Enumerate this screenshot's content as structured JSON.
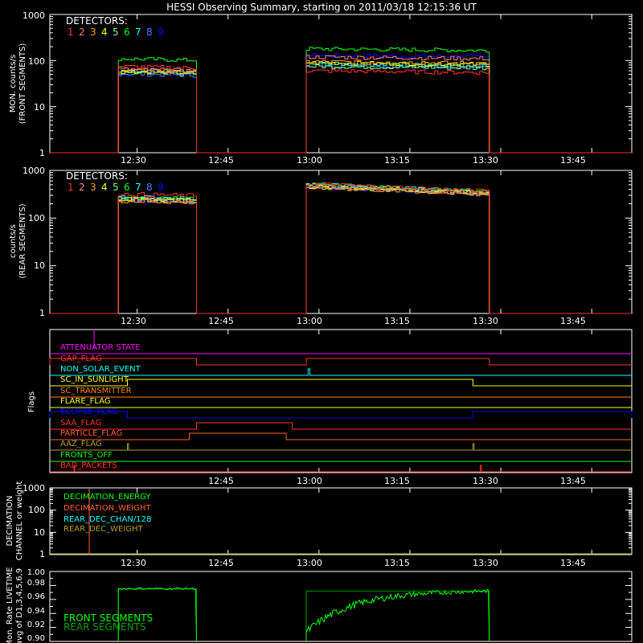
{
  "title": "HESSI Observing Summary, starting on 2011/03/18 12:15:36 UT",
  "colors": {
    "background": "#000000",
    "axis": "#ffffff",
    "det": [
      "#ff3030",
      "#ff8080",
      "#ffa500",
      "#ffff00",
      "#80ff80",
      "#00ff00",
      "#00ffff",
      "#4080ff",
      "#0000ff"
    ]
  },
  "chart_data": [
    {
      "id": "front",
      "type": "line",
      "ylabel": [
        "MON. counts/s",
        "(FRONT SEGMENTS)"
      ],
      "yscale": "log",
      "ylim": [
        1,
        1000
      ],
      "yticks": [
        "1",
        "10",
        "100",
        "1000"
      ],
      "xlim_min": [
        0,
        96
      ],
      "xticks": [
        {
          "min": 14.4,
          "label": "12:30"
        },
        {
          "min": 29.4,
          "label": "12:45"
        },
        {
          "min": 44.4,
          "label": "13:00"
        },
        {
          "min": 59.4,
          "label": "13:15"
        },
        {
          "min": 74.4,
          "label": "13:30"
        },
        {
          "min": 89.4,
          "label": "13:45"
        }
      ],
      "legend_title": "DETECTORS:",
      "legend_labels": [
        "1",
        "2",
        "3",
        "4",
        "5",
        "6",
        "7",
        "8",
        "9"
      ],
      "segments": [
        {
          "start": 11.3,
          "end": 24.2
        },
        {
          "start": 42.3,
          "end": 72.5
        }
      ],
      "series": [
        {
          "values": [
            75,
            60
          ]
        },
        {
          "values": [
            65,
            120
          ]
        },
        {
          "values": [
            60,
            95
          ]
        },
        {
          "values": [
            58,
            90
          ]
        },
        {
          "values": [
            62,
            75
          ]
        },
        {
          "values": [
            110,
            180
          ]
        },
        {
          "values": [
            55,
            85
          ]
        },
        {
          "values": [
            52,
            80
          ]
        },
        {
          "values": [
            60,
            130
          ]
        }
      ]
    },
    {
      "id": "rear",
      "type": "line",
      "ylabel": [
        "counts/s",
        "(REAR SEGMENTS)"
      ],
      "yscale": "log",
      "ylim": [
        1,
        1000
      ],
      "yticks": [
        "1",
        "10",
        "100",
        "1000"
      ],
      "xlim_min": [
        0,
        96
      ],
      "xticks": [
        {
          "min": 14.4,
          "label": "12:30"
        },
        {
          "min": 29.4,
          "label": "12:45"
        },
        {
          "min": 44.4,
          "label": "13:00"
        },
        {
          "min": 59.4,
          "label": "13:15"
        },
        {
          "min": 74.4,
          "label": "13:30"
        },
        {
          "min": 89.4,
          "label": "13:45"
        }
      ],
      "legend_title": "DETECTORS:",
      "legend_labels": [
        "1",
        "2",
        "3",
        "4",
        "5",
        "6",
        "7",
        "8",
        "9"
      ],
      "segments": [
        {
          "start": 11.3,
          "end": 24.2
        },
        {
          "start": 42.3,
          "end": 72.5
        }
      ],
      "series": [
        {
          "values": [
            320,
            520
          ]
        },
        {
          "values": [
            240,
            470
          ]
        },
        {
          "values": [
            230,
            440
          ]
        },
        {
          "values": [
            250,
            460
          ]
        },
        {
          "values": [
            260,
            480
          ]
        },
        {
          "values": [
            270,
            500
          ]
        },
        {
          "values": [
            280,
            510
          ]
        },
        {
          "values": [
            255,
            470
          ]
        },
        {
          "values": [
            240,
            450
          ]
        }
      ]
    },
    {
      "id": "flags",
      "type": "line",
      "ylabel": [
        "Flags"
      ],
      "xticks": [
        {
          "min": 29.4,
          "label": "12:45"
        },
        {
          "min": 44.4,
          "label": "13:00"
        },
        {
          "min": 59.4,
          "label": "13:15"
        },
        {
          "min": 74.4,
          "label": "13:30"
        },
        {
          "min": 89.4,
          "label": "13:45"
        }
      ],
      "flags": [
        {
          "name": "ATTENUATOR STATE",
          "color": "#ff00ff",
          "high": []
        },
        {
          "name": "GAP_FLAG",
          "color": "#ff3030",
          "high": [
            [
              0,
              24.2
            ],
            [
              42.3,
              72.5
            ]
          ]
        },
        {
          "name": "NON_SOLAR_EVENT",
          "color": "#00ffff",
          "high": [
            [
              42.6,
              42.9
            ]
          ]
        },
        {
          "name": "SC_IN_SUNLIGHT",
          "color": "#ffff00",
          "high": [
            [
              12.8,
              69.8
            ]
          ]
        },
        {
          "name": "SC_TRANSMITTER",
          "color": "#ff8000",
          "high": []
        },
        {
          "name": "FLARE_FLAG",
          "color": "#ffff00",
          "high": []
        },
        {
          "name": "ECLIPSE_FLAG",
          "color": "#0000ff",
          "high": [
            [
              0,
              12.8
            ],
            [
              69.8,
              96
            ]
          ]
        },
        {
          "name": "SAA_FLAG",
          "color": "#ff3030",
          "high": [
            [
              24.2,
              40.0
            ]
          ]
        },
        {
          "name": "PARTICLE_FLAG",
          "color": "#ff6030",
          "high": [
            [
              23.0,
              39.0
            ]
          ]
        },
        {
          "name": "AAZ_FLAG",
          "color": "#b0a020",
          "high": [
            [
              12.8,
              13.0
            ],
            [
              69.8,
              70.0
            ]
          ]
        },
        {
          "name": "FRONTS_OFF",
          "color": "#00ff00",
          "high": []
        },
        {
          "name": "BAD_PACKETS",
          "color": "#ff3030",
          "high": [
            [
              4.0,
              4.1
            ],
            [
              71.0,
              71.2
            ]
          ]
        }
      ]
    },
    {
      "id": "decimation",
      "type": "line",
      "ylabel": [
        "DECIMATION",
        "CHANNEL or weight"
      ],
      "yscale": "log",
      "ylim": [
        1,
        1000
      ],
      "yticks": [
        "1",
        "10",
        "100",
        "1000"
      ],
      "xticks": [
        {
          "min": 14.4,
          "label": "12:30"
        },
        {
          "min": 29.4,
          "label": "12:45"
        },
        {
          "min": 44.4,
          "label": "13:00"
        },
        {
          "min": 59.4,
          "label": "13:15"
        },
        {
          "min": 74.4,
          "label": "13:30"
        },
        {
          "min": 89.4,
          "label": "13:45"
        }
      ],
      "legend": [
        {
          "name": "DECIMATION_ENERGY",
          "color": "#00ff00"
        },
        {
          "name": "DECIMATION_WEIGHT",
          "color": "#ff6030"
        },
        {
          "name": "REAR_DEC_CHAN/128",
          "color": "#00ffff"
        },
        {
          "name": "REAR_DEC_WEIGHT",
          "color": "#b0a020"
        }
      ],
      "spike_min": 6.5
    },
    {
      "id": "livetime",
      "type": "line",
      "ylabel": [
        "Mon. Rate LIVETIME",
        "avg of D1,3,4,5,6,9"
      ],
      "ylim": [
        0.9,
        1.0
      ],
      "yticks": [
        "0.90",
        "0.92",
        "0.94",
        "0.96",
        "0.98",
        "1.00"
      ],
      "legend": [
        {
          "name": "FRONT SEGMENTS",
          "color": "#00ff00"
        },
        {
          "name": "REAR SEGMENTS",
          "color": "#00a000"
        }
      ],
      "segments": [
        {
          "start": 11.3,
          "end": 24.2
        },
        {
          "start": 42.3,
          "end": 72.5
        }
      ]
    }
  ]
}
